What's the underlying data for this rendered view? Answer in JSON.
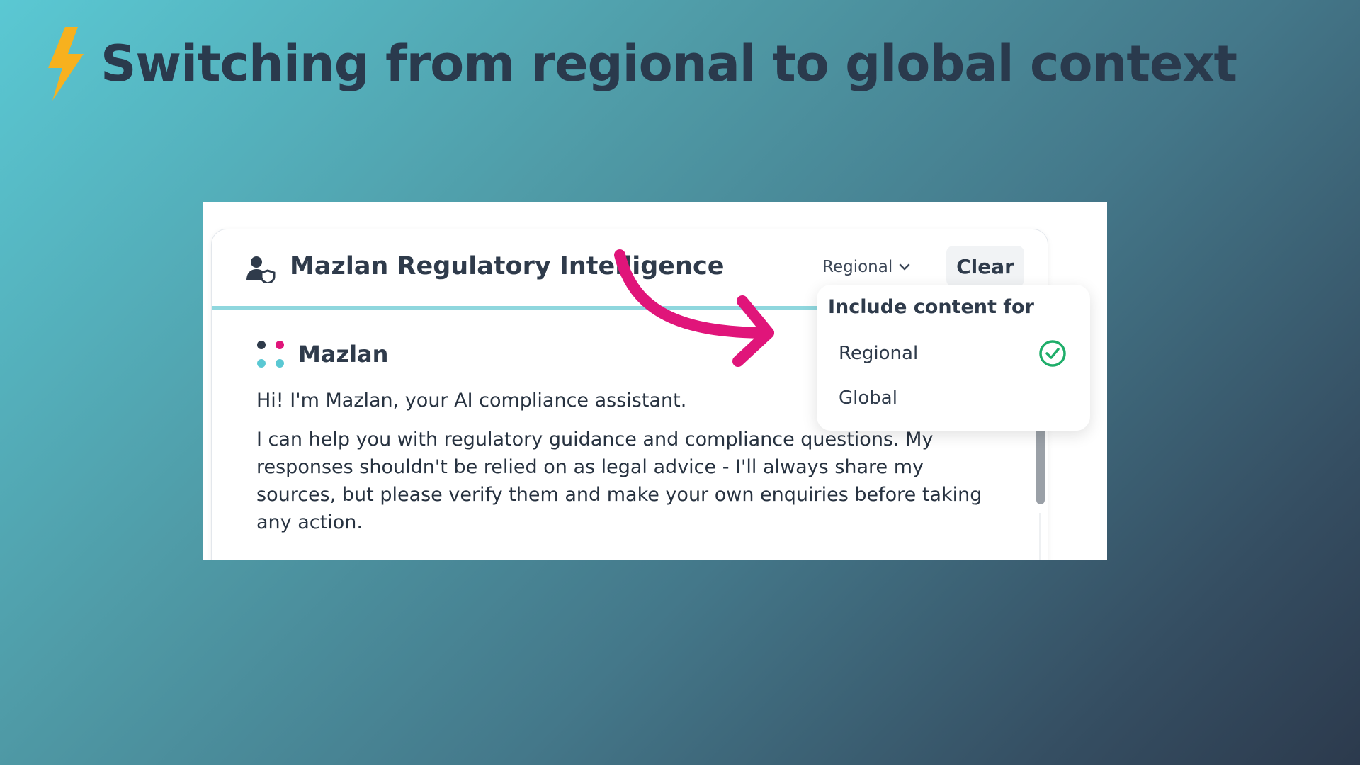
{
  "slide": {
    "title": "Switching from regional to global context",
    "title_icon": "lightning-bolt-icon"
  },
  "chat": {
    "header_icon": "user-shield-icon",
    "title": "Mazlan Regulatory Intelligence",
    "scope_selected": "Regional",
    "clear_label": "Clear",
    "assistant_name": "Mazlan",
    "assistant_logo": "mazlan-dots-logo",
    "messages": [
      "Hi! I'm Mazlan, your AI compliance assistant.",
      "I can help you with regulatory guidance and compliance questions. My responses shouldn't be relied on as legal advice - I'll always share my sources, but please verify them and make your own enquiries before taking any action."
    ]
  },
  "dropdown": {
    "heading": "Include content for",
    "options": [
      {
        "label": "Regional",
        "selected": true
      },
      {
        "label": "Global",
        "selected": false
      }
    ]
  },
  "colors": {
    "accent_teal": "#8fd7de",
    "annotation_arrow": "#e0157a",
    "check_green": "#1fae6a",
    "bolt_yellow": "#f7b11e",
    "title_dark": "#2a3a4d"
  }
}
